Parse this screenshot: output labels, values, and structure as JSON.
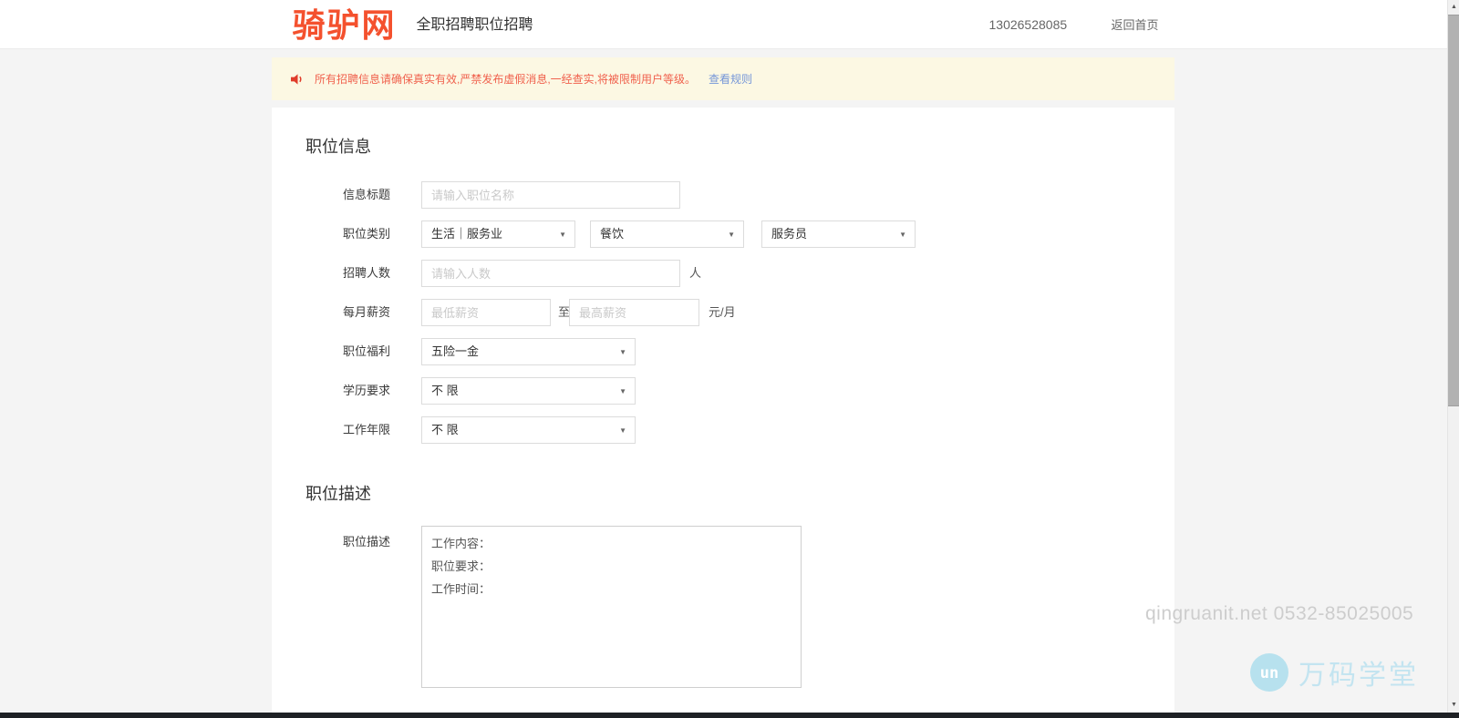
{
  "header": {
    "logo": "骑驴网",
    "subtitle": "全职招聘职位招聘",
    "phone": "13026528085",
    "back_home": "返回首页"
  },
  "notice": {
    "icon": "speaker-icon",
    "text": "所有招聘信息请确保真实有效,严禁发布虚假消息,一经查实,将被限制用户等级。",
    "link_label": "查看规则"
  },
  "form": {
    "section_info_title": "职位信息",
    "title_field": {
      "label": "信息标题",
      "placeholder": "请输入职位名称",
      "value": ""
    },
    "category": {
      "label": "职位类别",
      "selects": [
        {
          "value": "生活｜服务业"
        },
        {
          "value": "餐饮"
        },
        {
          "value": "服务员"
        }
      ]
    },
    "headcount": {
      "label": "招聘人数",
      "placeholder": "请输入人数",
      "unit": "人",
      "value": ""
    },
    "salary": {
      "label": "每月薪资",
      "min_placeholder": "最低薪资",
      "separator": "至",
      "max_placeholder": "最高薪资",
      "unit": "元/月",
      "min_value": "",
      "max_value": ""
    },
    "welfare": {
      "label": "职位福利",
      "value": "五险一金"
    },
    "education": {
      "label": "学历要求",
      "value": "不 限"
    },
    "experience": {
      "label": "工作年限",
      "value": "不 限"
    },
    "section_desc_title": "职位描述",
    "description": {
      "label": "职位描述",
      "value": "工作内容：\n职位要求：\n工作时间："
    }
  },
  "watermarks": {
    "site_watermark": "qingruanit.net 0532-85025005",
    "brand_icon": "wanma-circle-icon",
    "brand_icon_glyph": "un",
    "brand_name": "万码学堂"
  },
  "colors": {
    "brand_red": "#f4512e",
    "notice_bg": "#fcf8e3",
    "notice_text": "#f0614d",
    "link_blue": "#7596d8",
    "page_bg": "#f4f4f4",
    "watermark_gray": "#cdcdcd",
    "watermark_blue": "#c3e4f0"
  }
}
